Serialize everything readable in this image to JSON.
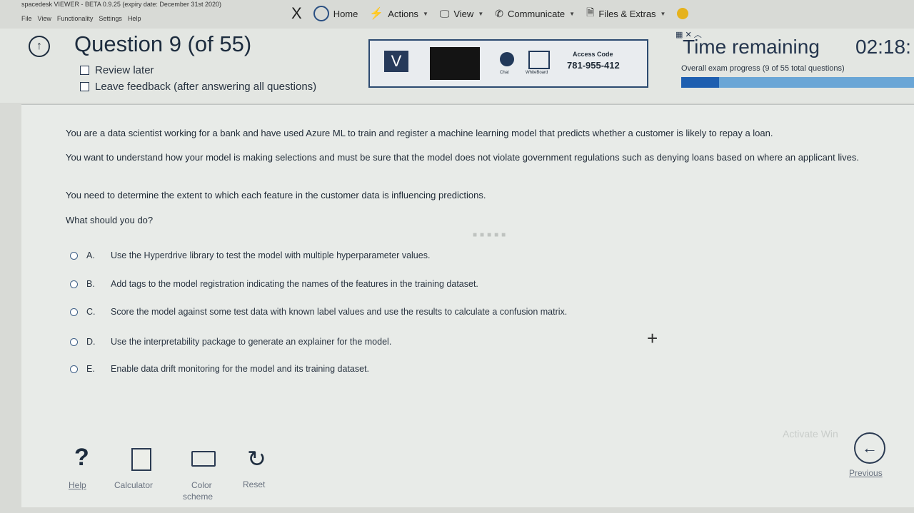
{
  "viewer": {
    "title": "spacedesk VIEWER - BETA 0.9.25 (expiry date: December 31st 2020)",
    "menu": [
      "File",
      "View",
      "Functionality",
      "Settings",
      "Help"
    ]
  },
  "toolbar": {
    "close_glyph": "X",
    "home": "Home",
    "actions": "Actions",
    "view": "View",
    "communicate": "Communicate",
    "files": "Files & Extras"
  },
  "header": {
    "question_title": "Question 9 (of 55)",
    "review_later": "Review later",
    "leave_feedback": "Leave feedback (after answering all questions)",
    "time_remaining_label": "Time remaining",
    "time_value": "02:18:",
    "progress_text": "Overall exam progress (9 of 55 total questions)",
    "progress_fraction": 0.164
  },
  "access_panel": {
    "badge": "V",
    "chat_label": "Chat",
    "whiteboard_label": "WhiteBoard",
    "access_label": "Access Code",
    "access_code": "781-955-412"
  },
  "question": {
    "p1": "You are a data scientist working for a bank and have used Azure ML to train and register a machine learning model that predicts whether a customer is likely to repay a loan.",
    "p2": "You want to understand how your model is making selections and must be sure that the model does not violate government regulations such as denying loans based on where an applicant lives.",
    "p3": "You need to determine the extent to which each feature in the customer data is influencing predictions.",
    "p4": "What should you do?",
    "options": [
      {
        "letter": "A.",
        "text": "Use the Hyperdrive library to test the model with multiple hyperparameter values."
      },
      {
        "letter": "B.",
        "text": "Add tags to the model registration indicating the names of the features in the training dataset."
      },
      {
        "letter": "C.",
        "text": "Score the model against some test data with known label values and use the results to calculate a confusion matrix."
      },
      {
        "letter": "D.",
        "text": "Use the interpretability package to generate an explainer for the model."
      },
      {
        "letter": "E.",
        "text": "Enable data drift monitoring for the model and its training dataset."
      }
    ]
  },
  "footer": {
    "help": "Help",
    "calculator": "Calculator",
    "color": "Color",
    "scheme": "scheme",
    "reset": "Reset",
    "previous": "Previous",
    "watermark": "Activate Win"
  },
  "colors": {
    "progress_fill": "#1e5fb0",
    "progress_track": "#6aa6d6",
    "accent": "#2c4a70"
  }
}
